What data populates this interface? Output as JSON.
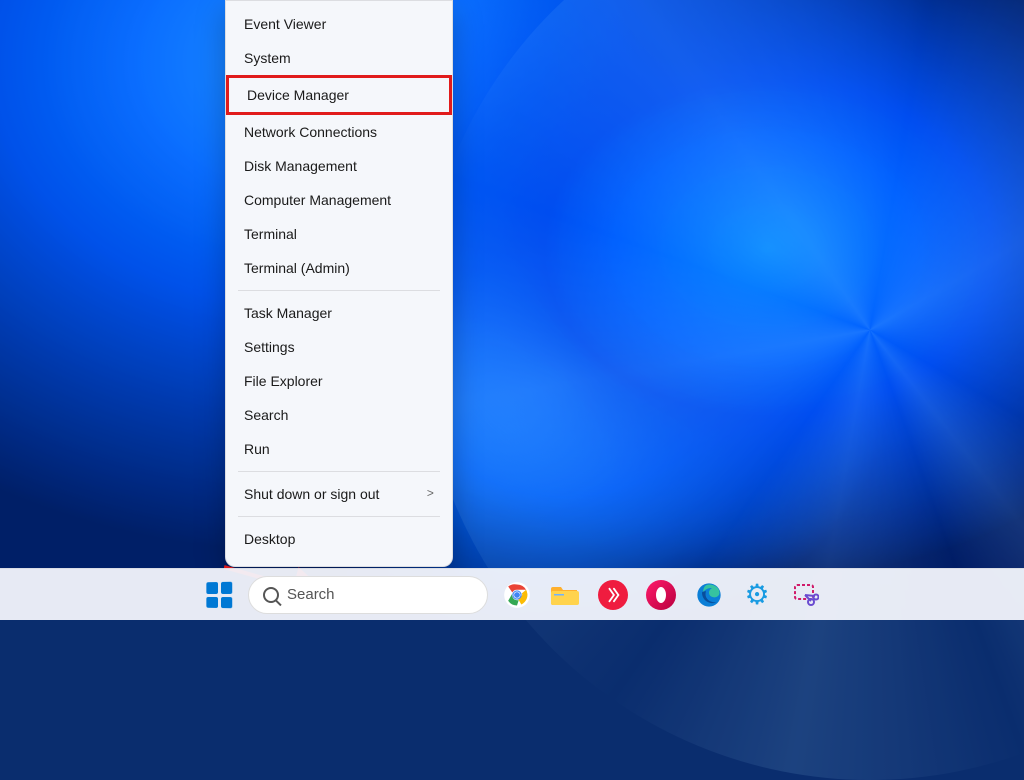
{
  "wallpaper_name": "Windows 11 Bloom",
  "context_menu": {
    "highlighted_index": 2,
    "items": [
      {
        "label": "Event Viewer",
        "submenu": false
      },
      {
        "label": "System",
        "submenu": false
      },
      {
        "label": "Device Manager",
        "submenu": false
      },
      {
        "label": "Network Connections",
        "submenu": false
      },
      {
        "label": "Disk Management",
        "submenu": false
      },
      {
        "label": "Computer Management",
        "submenu": false
      },
      {
        "label": "Terminal",
        "submenu": false
      },
      {
        "label": "Terminal (Admin)",
        "submenu": false
      },
      {
        "sep": true
      },
      {
        "label": "Task Manager",
        "submenu": false
      },
      {
        "label": "Settings",
        "submenu": false
      },
      {
        "label": "File Explorer",
        "submenu": false
      },
      {
        "label": "Search",
        "submenu": false
      },
      {
        "label": "Run",
        "submenu": false
      },
      {
        "sep": true
      },
      {
        "label": "Shut down or sign out",
        "submenu": true
      },
      {
        "sep": true
      },
      {
        "label": "Desktop",
        "submenu": false
      }
    ]
  },
  "taskbar": {
    "search_placeholder": "Search",
    "apps": [
      {
        "name": "start",
        "title": "Start"
      },
      {
        "name": "search",
        "title": "Search"
      },
      {
        "name": "chrome",
        "title": "Google Chrome",
        "bg": "#ffffff"
      },
      {
        "name": "file-explorer",
        "title": "File Explorer",
        "bg": "#ffd34d"
      },
      {
        "name": "anydesk",
        "title": "AnyDesk",
        "bg": "#ef1c3f"
      },
      {
        "name": "opera",
        "title": "Opera",
        "bg": "#ff1b6b"
      },
      {
        "name": "edge",
        "title": "Microsoft Edge",
        "bg": "#0b7ed6"
      },
      {
        "name": "settings-gear",
        "title": "Settings",
        "bg": "#199be2"
      },
      {
        "name": "snipping-tool",
        "title": "Snipping Tool",
        "bg": "#ffffff"
      }
    ]
  },
  "annotation": {
    "arrow_color": "#e11b1b",
    "target": "start-button"
  }
}
